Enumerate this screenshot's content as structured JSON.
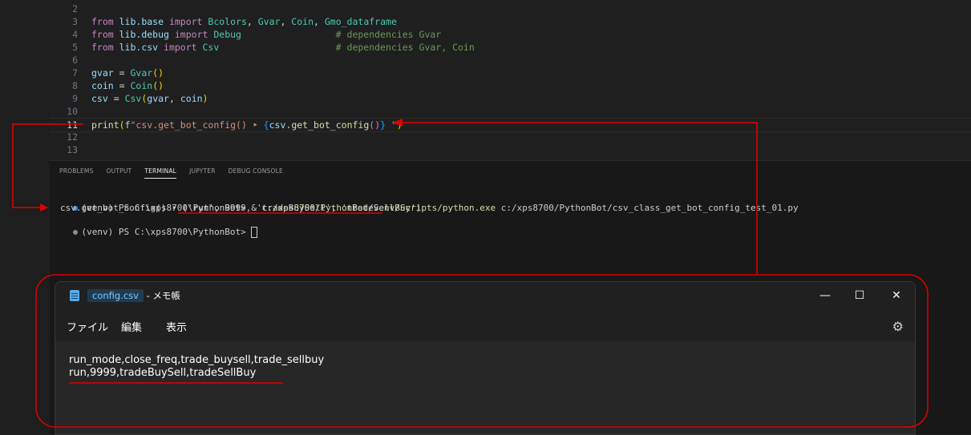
{
  "editor": {
    "lines": [
      {
        "num": "2",
        "tokens": []
      },
      {
        "num": "3",
        "tokens": [
          [
            "kw",
            "from "
          ],
          [
            "var",
            "lib.base "
          ],
          [
            "kw",
            "import "
          ],
          [
            "cls",
            "Bcolors"
          ],
          [
            "op",
            ", "
          ],
          [
            "cls",
            "Gvar"
          ],
          [
            "op",
            ", "
          ],
          [
            "cls",
            "Coin"
          ],
          [
            "op",
            ", "
          ],
          [
            "cls",
            "Gmo_dataframe"
          ]
        ]
      },
      {
        "num": "4",
        "tokens": [
          [
            "kw",
            "from "
          ],
          [
            "var",
            "lib.debug "
          ],
          [
            "kw",
            "import "
          ],
          [
            "cls",
            "Debug"
          ],
          [
            "op",
            "                 "
          ],
          [
            "cm",
            "# dependencies Gvar"
          ]
        ]
      },
      {
        "num": "5",
        "tokens": [
          [
            "kw",
            "from "
          ],
          [
            "var",
            "lib.csv "
          ],
          [
            "kw",
            "import "
          ],
          [
            "cls",
            "Csv"
          ],
          [
            "op",
            "                     "
          ],
          [
            "cm",
            "# dependencies Gvar, Coin"
          ]
        ]
      },
      {
        "num": "6",
        "tokens": []
      },
      {
        "num": "7",
        "tokens": [
          [
            "var",
            "gvar "
          ],
          [
            "op",
            "= "
          ],
          [
            "cls",
            "Gvar"
          ],
          [
            "brk",
            "()"
          ]
        ]
      },
      {
        "num": "8",
        "tokens": [
          [
            "var",
            "coin "
          ],
          [
            "op",
            "= "
          ],
          [
            "cls",
            "Coin"
          ],
          [
            "brk",
            "()"
          ]
        ]
      },
      {
        "num": "9",
        "tokens": [
          [
            "var",
            "csv "
          ],
          [
            "op",
            "= "
          ],
          [
            "cls",
            "Csv"
          ],
          [
            "brk",
            "("
          ],
          [
            "var",
            "gvar"
          ],
          [
            "op",
            ", "
          ],
          [
            "var",
            "coin"
          ],
          [
            "brk",
            ")"
          ]
        ]
      },
      {
        "num": "10",
        "tokens": []
      },
      {
        "num": "11",
        "tokens": [
          [
            "fn",
            "print"
          ],
          [
            "brk",
            "("
          ],
          [
            "var",
            "f"
          ],
          [
            "str",
            "\"csv.get_bot_config() ‣ "
          ],
          [
            "brk3",
            "{"
          ],
          [
            "var",
            "csv"
          ],
          [
            "op",
            "."
          ],
          [
            "fn",
            "get_bot_config"
          ],
          [
            "brk2",
            "()"
          ],
          [
            "brk3",
            "}"
          ],
          [
            "str",
            " \""
          ],
          [
            "brk",
            ")"
          ]
        ]
      },
      {
        "num": "12",
        "tokens": []
      },
      {
        "num": "13",
        "tokens": []
      }
    ]
  },
  "panel": {
    "tabs": [
      "PROBLEMS",
      "OUTPUT",
      "TERMINAL",
      "JUPYTER",
      "DEBUG CONSOLE"
    ],
    "active_tab": "TERMINAL",
    "terminal": {
      "prompt1": "(venv) PS C:\\xps8700\\PythonBot> ",
      "cmd_amp": "& ",
      "cmd_exe": "c:/xps8700/PythonBot/venv/Scripts/python.exe",
      "cmd_arg": " c:/xps8700/PythonBot/csv_class_get_bot_config_test_01.py",
      "output": "csv.get_bot_config() ‣ ('run', 9999, 'tradeBuySell', 'tradeSellBuy')",
      "prompt2": "(venv) PS C:\\xps8700\\PythonBot> "
    }
  },
  "notepad": {
    "file_name": "config.csv",
    "app_suffix": " - メモ帳",
    "minimize": "—",
    "maximize": "☐",
    "close": "✕",
    "menu": [
      "ファイル",
      "編集",
      "表示"
    ],
    "settings_icon": "⚙",
    "content": [
      "run_mode,close_freq,trade_buysell,trade_sellbuy",
      "run,9999,tradeBuySell,tradeSellBuy"
    ]
  },
  "colors": {
    "annotation": "#e00000",
    "accent": "#3794ff"
  }
}
